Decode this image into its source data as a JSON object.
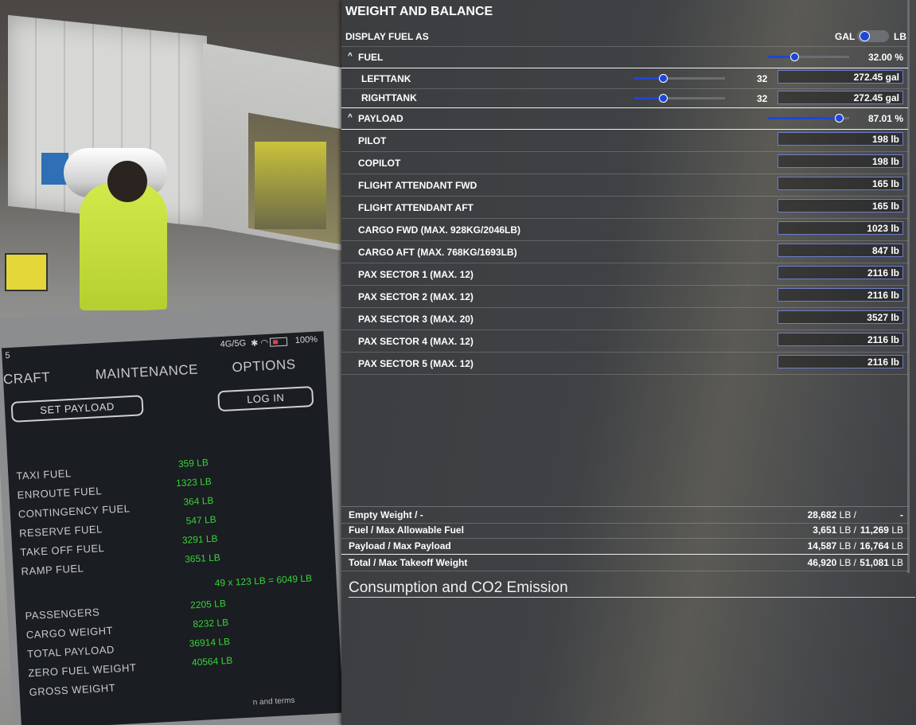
{
  "tablet": {
    "status": {
      "time": "5",
      "network": "4G/5G",
      "battery": "100%"
    },
    "tabs": [
      "CRAFT",
      "MAINTENANCE",
      "OPTIONS"
    ],
    "set_payload_label": "SET PAYLOAD",
    "login_label": "LOG IN",
    "fuel_rows": [
      {
        "label": "TAXI FUEL",
        "value": "359 LB"
      },
      {
        "label": "ENROUTE FUEL",
        "value": "1323 LB"
      },
      {
        "label": "CONTINGENCY FUEL",
        "value": "364 LB"
      },
      {
        "label": "RESERVE FUEL",
        "value": "547 LB"
      },
      {
        "label": "TAKE OFF FUEL",
        "value": "3291 LB"
      },
      {
        "label": "RAMP FUEL",
        "value": "3651 LB"
      }
    ],
    "pax_formula": "49 x 123 LB = 6049 LB",
    "payload_rows": [
      {
        "label": "PASSENGERS",
        "value": "2205 LB"
      },
      {
        "label": "CARGO WEIGHT",
        "value": "8232 LB"
      },
      {
        "label": "TOTAL PAYLOAD",
        "value": "36914 LB"
      },
      {
        "label": "ZERO FUEL WEIGHT",
        "value": "40564 LB"
      },
      {
        "label": "GROSS WEIGHT",
        "value": ""
      }
    ],
    "footer_text": "n and terms"
  },
  "wb": {
    "title": "WEIGHT AND BALANCE",
    "display_fuel_as": "DISPLAY FUEL AS",
    "unit_left": "GAL",
    "unit_right": "LB",
    "fuel": {
      "label": "FUEL",
      "percent": "32.00 %",
      "level": 0.32,
      "tanks": [
        {
          "label": "LEFTTANK",
          "level": 0.32,
          "num": "32",
          "value": "272.45 gal"
        },
        {
          "label": "RIGHTTANK",
          "level": 0.32,
          "num": "32",
          "value": "272.45 gal"
        }
      ]
    },
    "payload": {
      "label": "PAYLOAD",
      "percent": "87.01 %",
      "level": 0.87,
      "stations": [
        {
          "label": "PILOT",
          "value": "198 lb"
        },
        {
          "label": "COPILOT",
          "value": "198 lb"
        },
        {
          "label": "FLIGHT ATTENDANT FWD",
          "value": "165 lb"
        },
        {
          "label": "FLIGHT ATTENDANT AFT",
          "value": "165 lb"
        },
        {
          "label": "CARGO FWD (MAX. 928KG/2046LB)",
          "value": "1023 lb"
        },
        {
          "label": "CARGO AFT (MAX. 768KG/1693LB)",
          "value": "847 lb"
        },
        {
          "label": "PAX SECTOR 1 (MAX. 12)",
          "value": "2116 lb"
        },
        {
          "label": "PAX SECTOR 2 (MAX. 12)",
          "value": "2116 lb"
        },
        {
          "label": "PAX SECTOR 3 (MAX. 20)",
          "value": "3527 lb"
        },
        {
          "label": "PAX SECTOR 4 (MAX. 12)",
          "value": "2116 lb"
        },
        {
          "label": "PAX SECTOR 5 (MAX. 12)",
          "value": "2116 lb"
        }
      ]
    },
    "summary": [
      {
        "label": "Empty Weight / -",
        "v1": "28,682",
        "u1": "LB /",
        "v2": "-",
        "u2": ""
      },
      {
        "label": "Fuel / Max Allowable Fuel",
        "v1": "3,651",
        "u1": "LB /",
        "v2": "11,269",
        "u2": "LB"
      },
      {
        "label": "Payload / Max Payload",
        "v1": "14,587",
        "u1": "LB /",
        "v2": "16,764",
        "u2": "LB"
      },
      {
        "label": "Total / Max Takeoff Weight",
        "v1": "46,920",
        "u1": "LB /",
        "v2": "51,081",
        "u2": "LB"
      }
    ],
    "co2_title": "Consumption and CO2 Emission"
  }
}
